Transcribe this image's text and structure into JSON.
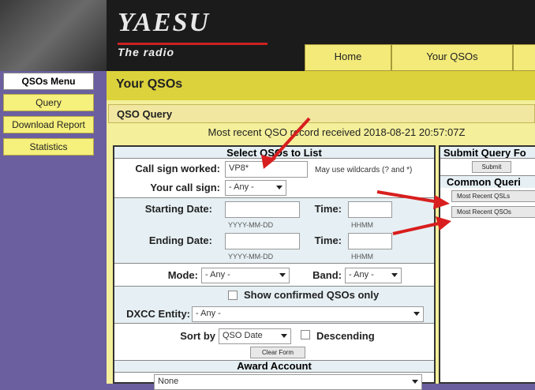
{
  "logo": {
    "brand": "YAESU",
    "tagline": "The radio"
  },
  "nav": {
    "tabs": [
      "Home",
      "Your QSOs"
    ]
  },
  "sidebar": {
    "header": "QSOs Menu",
    "items": [
      "Query",
      "Download Report",
      "Statistics"
    ]
  },
  "main": {
    "title": "Your QSOs",
    "section": "QSO Query",
    "recent": "Most recent QSO record received 2018-08-21 20:57:07Z"
  },
  "form": {
    "heading": "Select QSOs to List",
    "callsign_label": "Call sign worked:",
    "callsign_value": "VP8*",
    "wildcard_hint": "May use wildcards (? and *)",
    "yourcall_label": "Your call sign:",
    "yourcall_value": "- Any -",
    "start_label": "Starting Date:",
    "end_label": "Ending Date:",
    "time_label": "Time:",
    "date_fmt": "YYYY-MM-DD",
    "time_fmt": "HHMM",
    "mode_label": "Mode:",
    "mode_value": "- Any -",
    "band_label": "Band:",
    "band_value": "- Any -",
    "confirmed_label": "Show confirmed QSOs only",
    "dxcc_label": "DXCC Entity:",
    "dxcc_value": "- Any -",
    "sort_label": "Sort by",
    "sort_value": "QSO Date",
    "desc_label": "Descending",
    "clear_button": "Clear Form",
    "award_heading": "Award Account",
    "award_value": "None"
  },
  "side": {
    "heading": "Submit Query Fo",
    "submit_button": "Submit",
    "common_heading": "Common Queri",
    "recent_qsls": "Most Recent QSLs",
    "recent_qsos": "Most Recent QSOs"
  },
  "colors": {
    "accent": "#dcd23c",
    "sidebar": "#6b5fa0",
    "arrow": "#d81e1e"
  }
}
